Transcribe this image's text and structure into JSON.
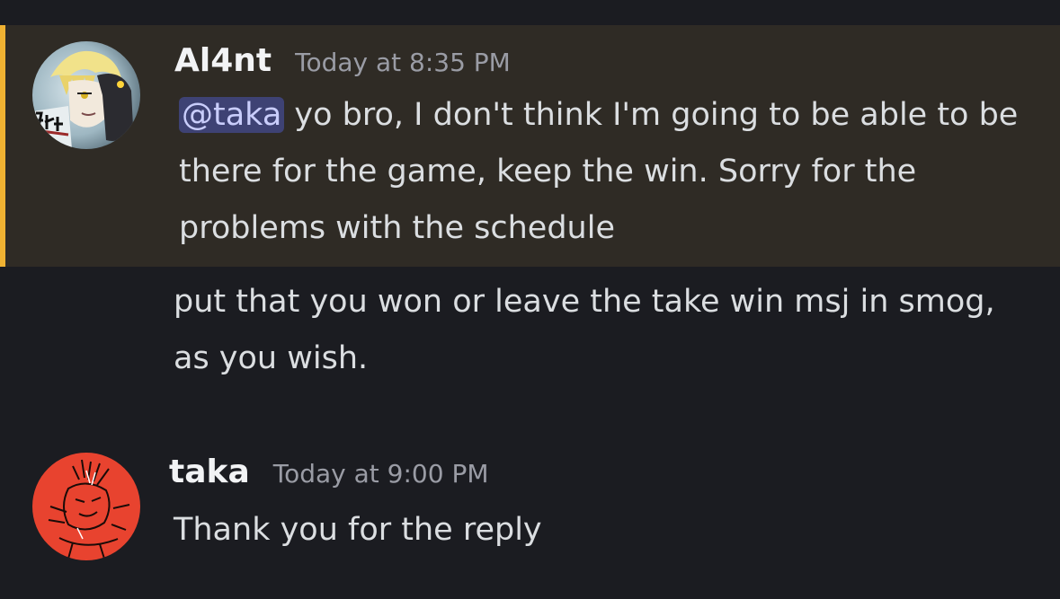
{
  "messages": [
    {
      "author": "Al4nt",
      "timestamp": "Today at 8:35 PM",
      "mention": "@taka",
      "text": " yo bro, I don't think I'm going to be able to be there for the game, keep the win. Sorry for the problems with the schedule",
      "highlighted": true
    },
    {
      "author": "Al4nt",
      "continued": true,
      "text": "put that you won or leave the take win msj in smog, as you wish."
    },
    {
      "author": "taka",
      "timestamp": "Today at 9:00 PM",
      "text": "Thank you for the reply"
    }
  ],
  "colors": {
    "background": "#1b1c21",
    "highlight_background": "#2f2b25",
    "highlight_bar": "#f0b232",
    "mention_background": "#3e4274",
    "mention_text": "#c9cdfb",
    "username": "#f2f3f5",
    "timestamp": "#9a9ca5",
    "message_text": "#dbdee1"
  },
  "icons": {
    "al4nt_avatar": "avatar-anime-character-icon",
    "taka_avatar": "avatar-red-sketch-icon"
  }
}
